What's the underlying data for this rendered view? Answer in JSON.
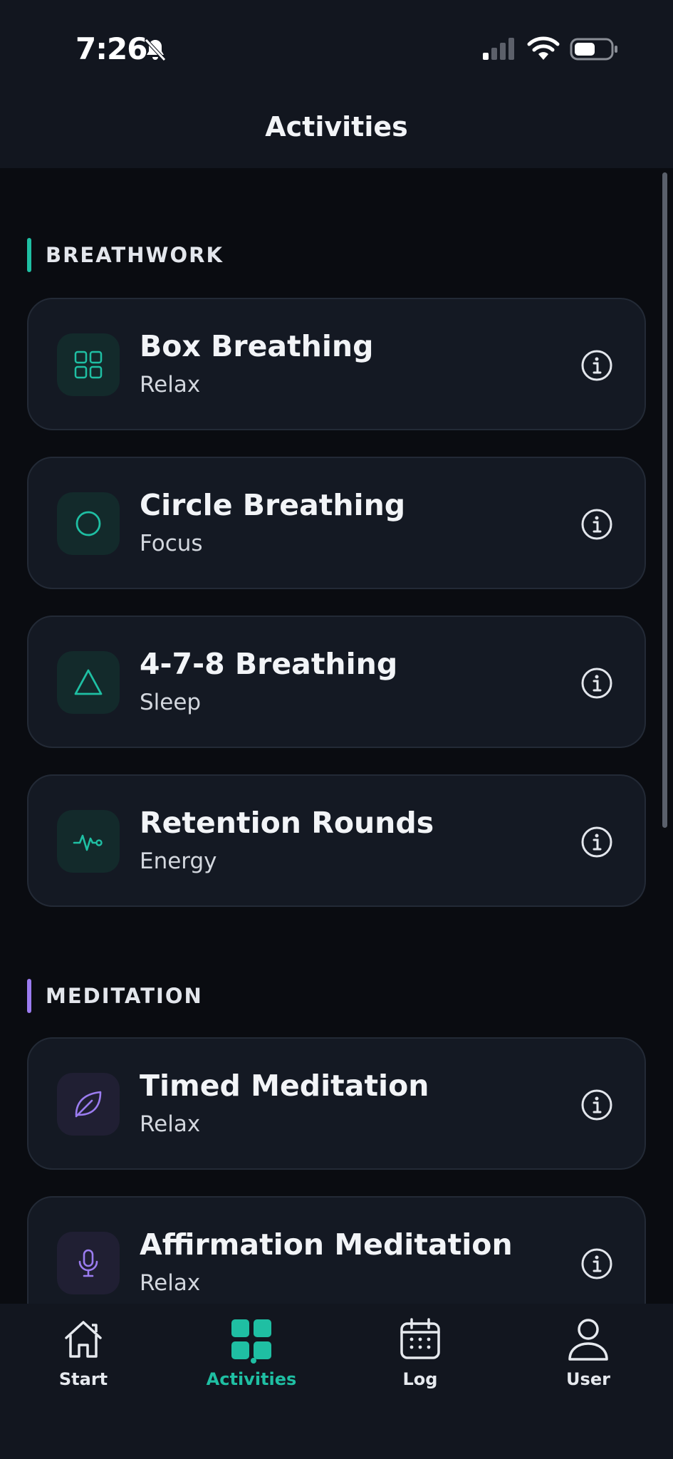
{
  "status": {
    "time": "7:26"
  },
  "header": {
    "title": "Activities"
  },
  "sections": [
    {
      "title": "BREATHWORK",
      "accent": "#1fbfa3",
      "items": [
        {
          "title": "Box Breathing",
          "subtitle": "Relax",
          "icon": "grid-icon"
        },
        {
          "title": "Circle Breathing",
          "subtitle": "Focus",
          "icon": "circle-icon"
        },
        {
          "title": "4-7-8 Breathing",
          "subtitle": "Sleep",
          "icon": "triangle-icon"
        },
        {
          "title": "Retention Rounds",
          "subtitle": "Energy",
          "icon": "pulse-icon"
        }
      ]
    },
    {
      "title": "MEDITATION",
      "accent": "#9b7cf0",
      "items": [
        {
          "title": "Timed Meditation",
          "subtitle": "Relax",
          "icon": "leaf-icon"
        },
        {
          "title": "Affirmation Meditation",
          "subtitle": "Relax",
          "icon": "microphone-icon"
        }
      ]
    }
  ],
  "tabs": [
    {
      "label": "Start",
      "icon": "home-icon",
      "active": false
    },
    {
      "label": "Activities",
      "icon": "apps-icon",
      "active": true
    },
    {
      "label": "Log",
      "icon": "calendar-icon",
      "active": false
    },
    {
      "label": "User",
      "icon": "user-icon",
      "active": false
    }
  ],
  "colors": {
    "accent_teal": "#1fbfa3",
    "accent_purple": "#9b7cf0",
    "background": "#0a0c11",
    "card": "#141923"
  }
}
